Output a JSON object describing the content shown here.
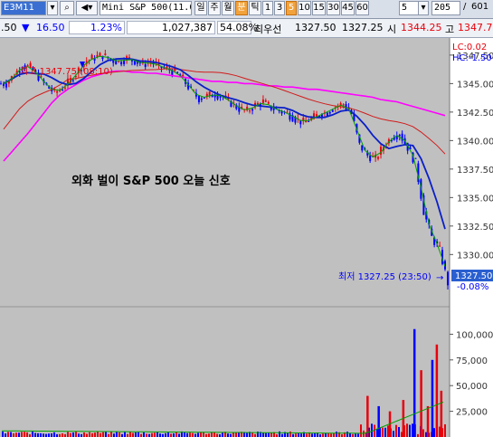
{
  "toolbar": {
    "code": "E3M11",
    "product": "Mini S&P 500(11.0",
    "period_buttons": [
      "일",
      "주",
      "월",
      "분",
      "틱",
      "1",
      "3",
      "5",
      "10",
      "15",
      "30",
      "45",
      "60"
    ],
    "selected_period": "분",
    "selected_interval": "5",
    "interval_select": "5",
    "page_current": "205",
    "page_total": "601"
  },
  "status": {
    "price": ".50",
    "change_arrow": "▼",
    "change": "16.50",
    "change_pct": "1.23%",
    "volume": "1,027,387",
    "prev_vol_ratio": "54.08%",
    "best_label": "최우선",
    "best_bid": "1327.50",
    "best_ask": "1327.25",
    "open_label": "시",
    "open": "1344.25",
    "high_label": "고",
    "high": "1347.7"
  },
  "chart": {
    "overlay_text": "외화 벌이 S&P 500 오늘 신호",
    "high_note": "최고 1347.75 (08:10)",
    "low_note": "최저 1327.25 (23:50)",
    "lc_label": "LC:0.02",
    "hc_label": "HC:-1.50",
    "last_price_tag": "1327.50",
    "last_change_tag": "-0.08%",
    "price_ticks": [
      "1347.50",
      "1345.00",
      "1342.50",
      "1340.00",
      "1337.50",
      "1335.00",
      "1332.50",
      "1330.00"
    ],
    "volume_ticks": [
      "100,000",
      "75,000",
      "50,000",
      "25,000"
    ],
    "colors": {
      "up": "#e8000b",
      "down": "#0000ff",
      "ma_short": "#00a000",
      "ma_mid": "#0a1fc8",
      "ma_long": "#d21b1b",
      "ma_longest": "#ff00ff",
      "panel_bg": "#c0c0c0"
    }
  },
  "chart_data": {
    "type": "candlestick",
    "price_axis": {
      "min": 1325.5,
      "max": 1349.0
    },
    "price_series": {
      "name": "",
      "y": [
        1345.0,
        1345.8,
        1346.6,
        1346.4,
        1345.6,
        1344.8,
        1344.2,
        1344.6,
        1345.3,
        1346.2,
        1347.0,
        1347.3,
        1347.5,
        1347.1,
        1346.9,
        1347.2,
        1347.0,
        1346.7,
        1346.9,
        1346.5,
        1346.3,
        1346.0,
        1345.4,
        1344.4,
        1343.7,
        1343.9,
        1344.1,
        1343.8,
        1343.3,
        1342.8,
        1342.6,
        1343.1,
        1343.4,
        1342.9,
        1342.6,
        1342.4,
        1341.9,
        1341.6,
        1341.9,
        1342.3,
        1342.5,
        1343.0,
        1343.2,
        1342.4,
        1339.6,
        1338.7,
        1338.4,
        1339.5,
        1340.3,
        1340.6,
        1339.4,
        1338.0,
        1333.8,
        1331.5,
        1330.4,
        1327.5
      ]
    },
    "volume_axis": {
      "min": 0,
      "max": 125000
    },
    "volume_spikes": [
      {
        "at": 0.82,
        "value": 40000
      },
      {
        "at": 0.845,
        "value": 30000
      },
      {
        "at": 0.87,
        "value": 25000
      },
      {
        "at": 0.9,
        "value": 36000
      },
      {
        "at": 0.925,
        "value": 105000
      },
      {
        "at": 0.94,
        "value": 65000
      },
      {
        "at": 0.955,
        "value": 30000
      },
      {
        "at": 0.965,
        "value": 75000
      },
      {
        "at": 0.975,
        "value": 90000
      },
      {
        "at": 0.985,
        "value": 45000
      }
    ]
  }
}
